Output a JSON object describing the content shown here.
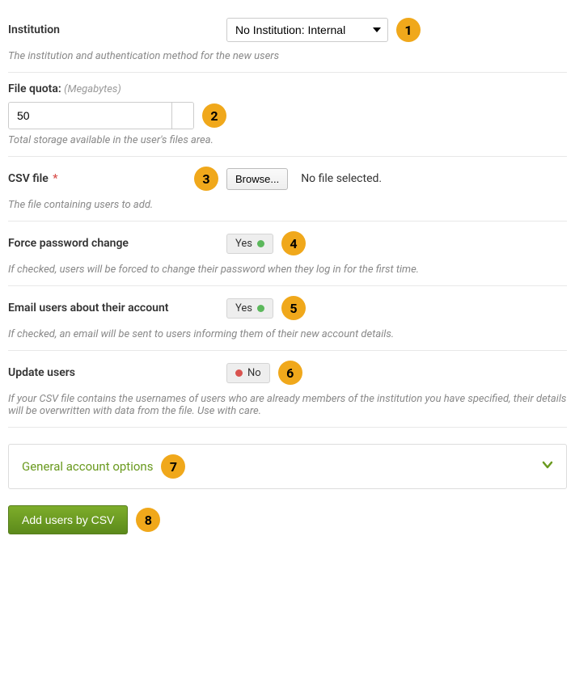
{
  "institution": {
    "label": "Institution",
    "selected": "No Institution: Internal",
    "help": "The institution and authentication method for the new users",
    "marker": "1"
  },
  "quota": {
    "label": "File quota:",
    "unit_hint": "(Megabytes)",
    "value": "50",
    "help": "Total storage available in the user's files area.",
    "marker": "2"
  },
  "csv": {
    "label": "CSV file",
    "required": "*",
    "browse": "Browse...",
    "status": "No file selected.",
    "help": "The file containing users to add.",
    "marker": "3"
  },
  "force_password": {
    "label": "Force password change",
    "value": "Yes",
    "help": "If checked, users will be forced to change their password when they log in for the first time.",
    "marker": "4"
  },
  "email_users": {
    "label": "Email users about their account",
    "value": "Yes",
    "help": "If checked, an email will be sent to users informing them of their new account details.",
    "marker": "5"
  },
  "update_users": {
    "label": "Update users",
    "value": "No",
    "help": "If your CSV file contains the usernames of users who are already members of the institution you have specified, their details will be overwritten with data from the file. Use with care.",
    "marker": "6"
  },
  "accordion": {
    "title": "General account options",
    "marker": "7"
  },
  "submit": {
    "label": "Add users by CSV",
    "marker": "8"
  }
}
